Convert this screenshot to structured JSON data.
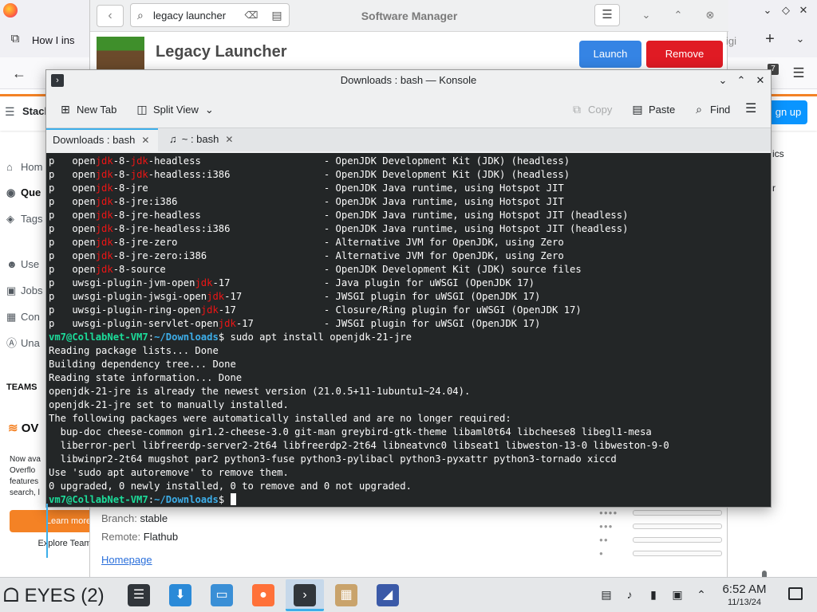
{
  "firefox": {
    "tab_title": "How I ins",
    "new_tab_symbol": "+",
    "stackoverflow": {
      "logo_text": "Stack",
      "signup_label": "gn up",
      "nav": [
        {
          "label": "Hom",
          "icon": "home-icon"
        },
        {
          "label": "Que",
          "icon": "questions-icon"
        },
        {
          "label": "Tags",
          "icon": "tag-icon"
        },
        {
          "label": "Use",
          "icon": "users-icon"
        },
        {
          "label": "Jobs",
          "icon": "jobs-icon"
        },
        {
          "label": "Con",
          "icon": "companies-icon"
        },
        {
          "label": "Una",
          "icon": "unanswered-icon"
        }
      ],
      "teams_heading": "TEAMS",
      "teams_logo": "OV",
      "teams_text": "Now ava Overflo features search, l",
      "learn_more": "Learn more",
      "explore": "Explore Team",
      "right_snippets": [
        "ics",
        "r"
      ]
    }
  },
  "software_manager": {
    "title": "Software Manager",
    "search_value": "legacy launcher",
    "app_name": "Legacy Launcher",
    "launch_label": "Launch",
    "remove_label": "Remove",
    "overflow_text": "igi",
    "details": {
      "branch_key": "Branch:",
      "branch_value": "stable",
      "remote_key": "Remote:",
      "remote_value": "Flathub",
      "homepage_link": "Homepage"
    },
    "colors": {
      "launch": "#3584e4",
      "remove": "#e01b24"
    }
  },
  "konsole": {
    "title": "Downloads : bash — Konsole",
    "toolbar": {
      "new_tab": "New Tab",
      "split_view": "Split View",
      "copy": "Copy",
      "paste": "Paste",
      "find": "Find"
    },
    "tabs": [
      {
        "label": "Downloads : bash",
        "active": true
      },
      {
        "label": "~ : bash",
        "active": false
      }
    ],
    "prompt_user": "vm7@CollabNet-VM7",
    "prompt_path": "~/Downloads",
    "package_lines": [
      {
        "status": "p",
        "pre": "open",
        "hl": "jdk",
        "post": "-8-",
        "hl2": "jdk",
        "post2": "-headless",
        "desc": "- OpenJDK Development Kit (JDK) (headless)"
      },
      {
        "status": "p",
        "pre": "open",
        "hl": "jdk",
        "post": "-8-",
        "hl2": "jdk",
        "post2": "-headless:i386",
        "desc": "- OpenJDK Development Kit (JDK) (headless)"
      },
      {
        "status": "p",
        "pre": "open",
        "hl": "jdk",
        "post": "-8-jre",
        "hl2": "",
        "post2": "",
        "desc": "- OpenJDK Java runtime, using Hotspot JIT"
      },
      {
        "status": "p",
        "pre": "open",
        "hl": "jdk",
        "post": "-8-jre:i386",
        "hl2": "",
        "post2": "",
        "desc": "- OpenJDK Java runtime, using Hotspot JIT"
      },
      {
        "status": "p",
        "pre": "open",
        "hl": "jdk",
        "post": "-8-jre-headless",
        "hl2": "",
        "post2": "",
        "desc": "- OpenJDK Java runtime, using Hotspot JIT (headless)"
      },
      {
        "status": "p",
        "pre": "open",
        "hl": "jdk",
        "post": "-8-jre-headless:i386",
        "hl2": "",
        "post2": "",
        "desc": "- OpenJDK Java runtime, using Hotspot JIT (headless)"
      },
      {
        "status": "p",
        "pre": "open",
        "hl": "jdk",
        "post": "-8-jre-zero",
        "hl2": "",
        "post2": "",
        "desc": "- Alternative JVM for OpenJDK, using Zero"
      },
      {
        "status": "p",
        "pre": "open",
        "hl": "jdk",
        "post": "-8-jre-zero:i386",
        "hl2": "",
        "post2": "",
        "desc": "- Alternative JVM for OpenJDK, using Zero"
      },
      {
        "status": "p",
        "pre": "open",
        "hl": "jdk",
        "post": "-8-source",
        "hl2": "",
        "post2": "",
        "desc": "- OpenJDK Development Kit (JDK) source files"
      },
      {
        "status": "p",
        "pre": "uwsgi-plugin-jvm-open",
        "hl": "jdk",
        "post": "-17",
        "hl2": "",
        "post2": "",
        "desc": "- Java plugin for uWSGI (OpenJDK 17)"
      },
      {
        "status": "p",
        "pre": "uwsgi-plugin-jwsgi-open",
        "hl": "jdk",
        "post": "-17",
        "hl2": "",
        "post2": "",
        "desc": "- JWSGI plugin for uWSGI (OpenJDK 17)"
      },
      {
        "status": "p",
        "pre": "uwsgi-plugin-ring-open",
        "hl": "jdk",
        "post": "-17",
        "hl2": "",
        "post2": "",
        "desc": "- Closure/Ring plugin for uWSGI (OpenJDK 17)"
      },
      {
        "status": "p",
        "pre": "uwsgi-plugin-servlet-open",
        "hl": "jdk",
        "post": "-17",
        "hl2": "",
        "post2": "",
        "desc": "- JWSGI plugin for uWSGI (OpenJDK 17)"
      }
    ],
    "command": " sudo apt install openjdk-21-jre",
    "output_lines": [
      "Reading package lists... Done",
      "Building dependency tree... Done",
      "Reading state information... Done",
      "openjdk-21-jre is already the newest version (21.0.5+11-1ubuntu1~24.04).",
      "openjdk-21-jre set to manually installed.",
      "The following packages were automatically installed and are no longer required:",
      "  bup-doc cheese-common gir1.2-cheese-3.0 git-man greybird-gtk-theme libaml0t64 libcheese8 libegl1-mesa",
      "  liberror-perl libfreerdp-server2-2t64 libfreerdp2-2t64 libneatvnc0 libseat1 libweston-13-0 libweston-9-0",
      "  libwinpr2-2t64 mugshot par2 python3-fuse python3-pylibacl python3-pyxattr python3-tornado xiccd",
      "Use 'sudo apt autoremove' to remove them.",
      "0 upgraded, 0 newly installed, 0 to remove and 0 not upgraded."
    ],
    "colors": {
      "background": "#232627",
      "prompt": "#1cdc9a",
      "path": "#3daee9",
      "highlight": "#ed1515"
    }
  },
  "taskbar": {
    "eyes_label": "EYES (2)",
    "apps": [
      {
        "name": "app-settings",
        "icon": "sliders-icon",
        "active": false,
        "color": "#31363b"
      },
      {
        "name": "app-software-manager",
        "icon": "package-store-icon",
        "active": false,
        "color": "#2b8ad8"
      },
      {
        "name": "app-file-manager",
        "icon": "folder-icon",
        "active": false,
        "color": "#3a8fd6"
      },
      {
        "name": "app-firefox",
        "icon": "firefox-icon",
        "active": false,
        "color": "#ff7139"
      },
      {
        "name": "app-konsole",
        "icon": "terminal-icon",
        "active": true,
        "color": "#31363b"
      },
      {
        "name": "app-archive",
        "icon": "archive-icon",
        "active": false,
        "color": "#c9a36b"
      },
      {
        "name": "app-security",
        "icon": "shield-icon",
        "active": false,
        "color": "#3b5aa8"
      }
    ],
    "time": "6:52 AM",
    "date": "11/13/24"
  }
}
